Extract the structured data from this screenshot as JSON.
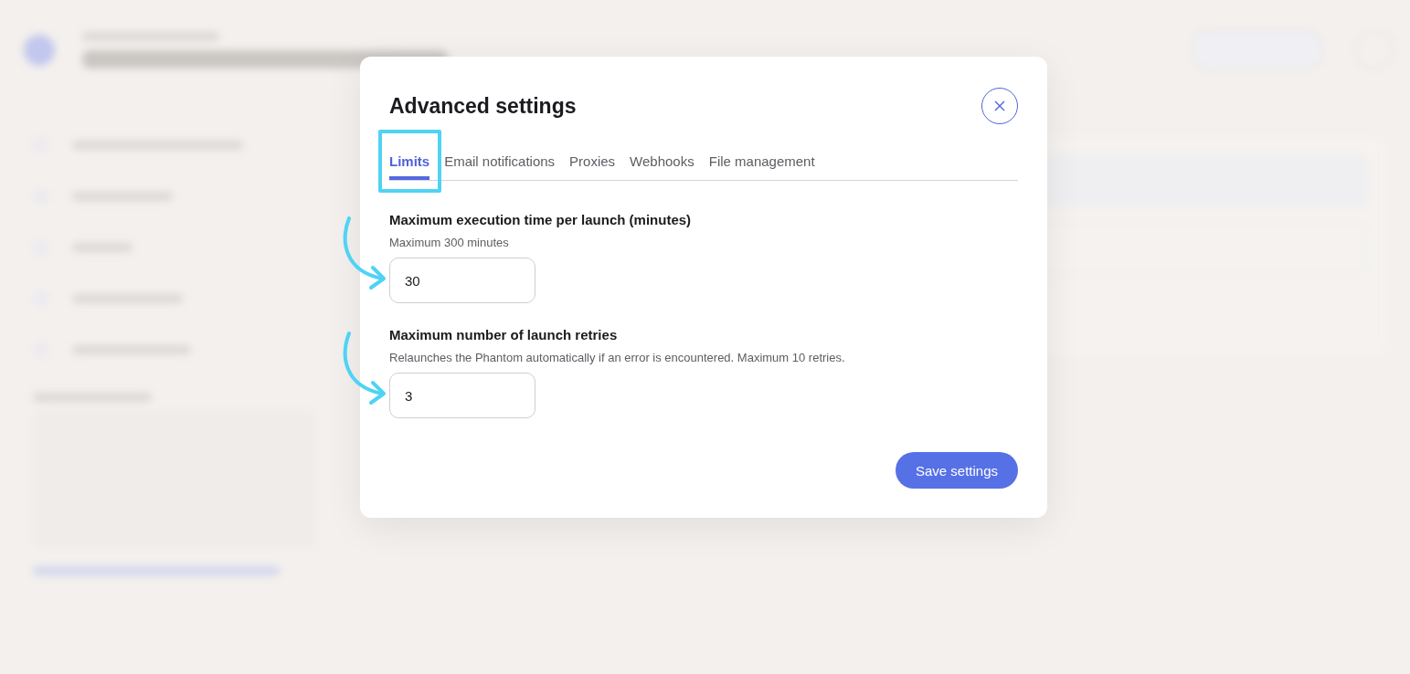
{
  "modal": {
    "title": "Advanced settings",
    "tabs": [
      {
        "label": "Limits",
        "selected": true
      },
      {
        "label": "Email notifications",
        "selected": false
      },
      {
        "label": "Proxies",
        "selected": false
      },
      {
        "label": "Webhooks",
        "selected": false
      },
      {
        "label": "File management",
        "selected": false
      }
    ],
    "fields": [
      {
        "label": "Maximum execution time per launch (minutes)",
        "hint": "Maximum 300 minutes",
        "value": "30"
      },
      {
        "label": "Maximum number of launch retries",
        "hint": "Relaunches the Phantom automatically if an error is encountered. Maximum 10 retries.",
        "value": "3"
      }
    ],
    "save_button": "Save settings"
  }
}
